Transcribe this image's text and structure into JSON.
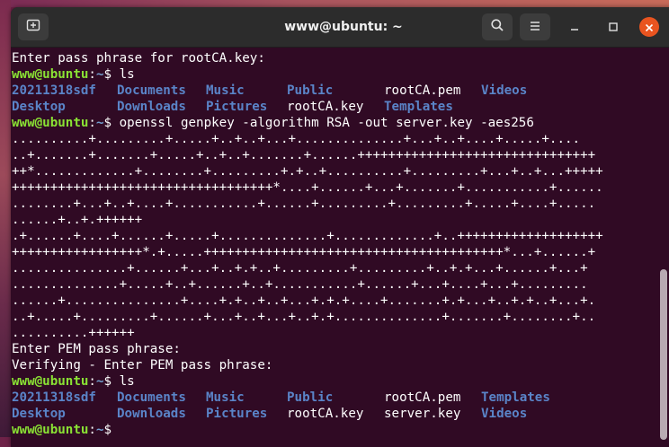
{
  "window": {
    "title": "www@ubuntu: ~"
  },
  "icons": {
    "new_tab": "new-tab-icon",
    "search": "search-icon",
    "menu": "hamburger-menu-icon",
    "minimize": "minimize-icon",
    "maximize": "maximize-icon",
    "close": "close-icon"
  },
  "colors": {
    "terminal_bg": "#300a24",
    "prompt_user": "#8ae234",
    "prompt_path": "#729fcf",
    "directory": "#3465a4",
    "close_button": "#e95420"
  },
  "prompt": {
    "user": "www@ubuntu",
    "colon": ":",
    "path": "~",
    "symbol": "$ "
  },
  "terminal": {
    "l1": "Enter pass phrase for rootCA.key:",
    "cmd1": "ls",
    "ls1_row1": {
      "c1": "20211318sdf",
      "c2": "Documents",
      "c3": "Music",
      "c4": "Public",
      "c5": "rootCA.pem",
      "c6": "Videos"
    },
    "ls1_row2": {
      "c1": "Desktop",
      "c2": "Downloads",
      "c3": "Pictures",
      "c4": "rootCA.key",
      "c5": "Templates"
    },
    "cmd2": "openssl genpkey -algorithm RSA -out server.key -aes256",
    "gen": [
      "..........+.........+.....+..+..+...+..............+...+..+....+.....+....",
      "..+.......+.......+.....+..+..+.......+......+++++++++++++++++++++++++++++++",
      "++*.............+........+.........+.+..+..........+.........+...+..+...+++++",
      "++++++++++++++++++++++++++++++++++*....+......+...+.......+...........+......",
      "........+...+..+....+...........+......+.........+.........+.....+....+.....",
      "......+..+.++++++",
      ".+......+....+......+.....+..............+.............+..+++++++++++++++++++",
      "+++++++++++++++++*.+.....+++++++++++++++++++++++++++++++++++++++*...+......+",
      "...............+......+...+..+.+..+.........+.........+..+.+...+......+...+",
      "..............+.....+..+......+..+...........+......+...+....+...+.........",
      "......+...............+....+.+..+..+...+.+.+....+.......+.+...+..+.+..+...+.",
      "..+.....+.........+......+...+..+...+..+.+..............+.......+........+..",
      "..........++++++"
    ],
    "pem1": "Enter PEM pass phrase:",
    "pem2": "Verifying - Enter PEM pass phrase:",
    "cmd3": "ls",
    "ls2_row1": {
      "c1": "20211318sdf",
      "c2": "Documents",
      "c3": "Music",
      "c4": "Public",
      "c5": "rootCA.pem",
      "c6": "Templates"
    },
    "ls2_row2": {
      "c1": "Desktop",
      "c2": "Downloads",
      "c3": "Pictures",
      "c4": "rootCA.key",
      "c5": "server.key",
      "c6": "Videos"
    }
  }
}
